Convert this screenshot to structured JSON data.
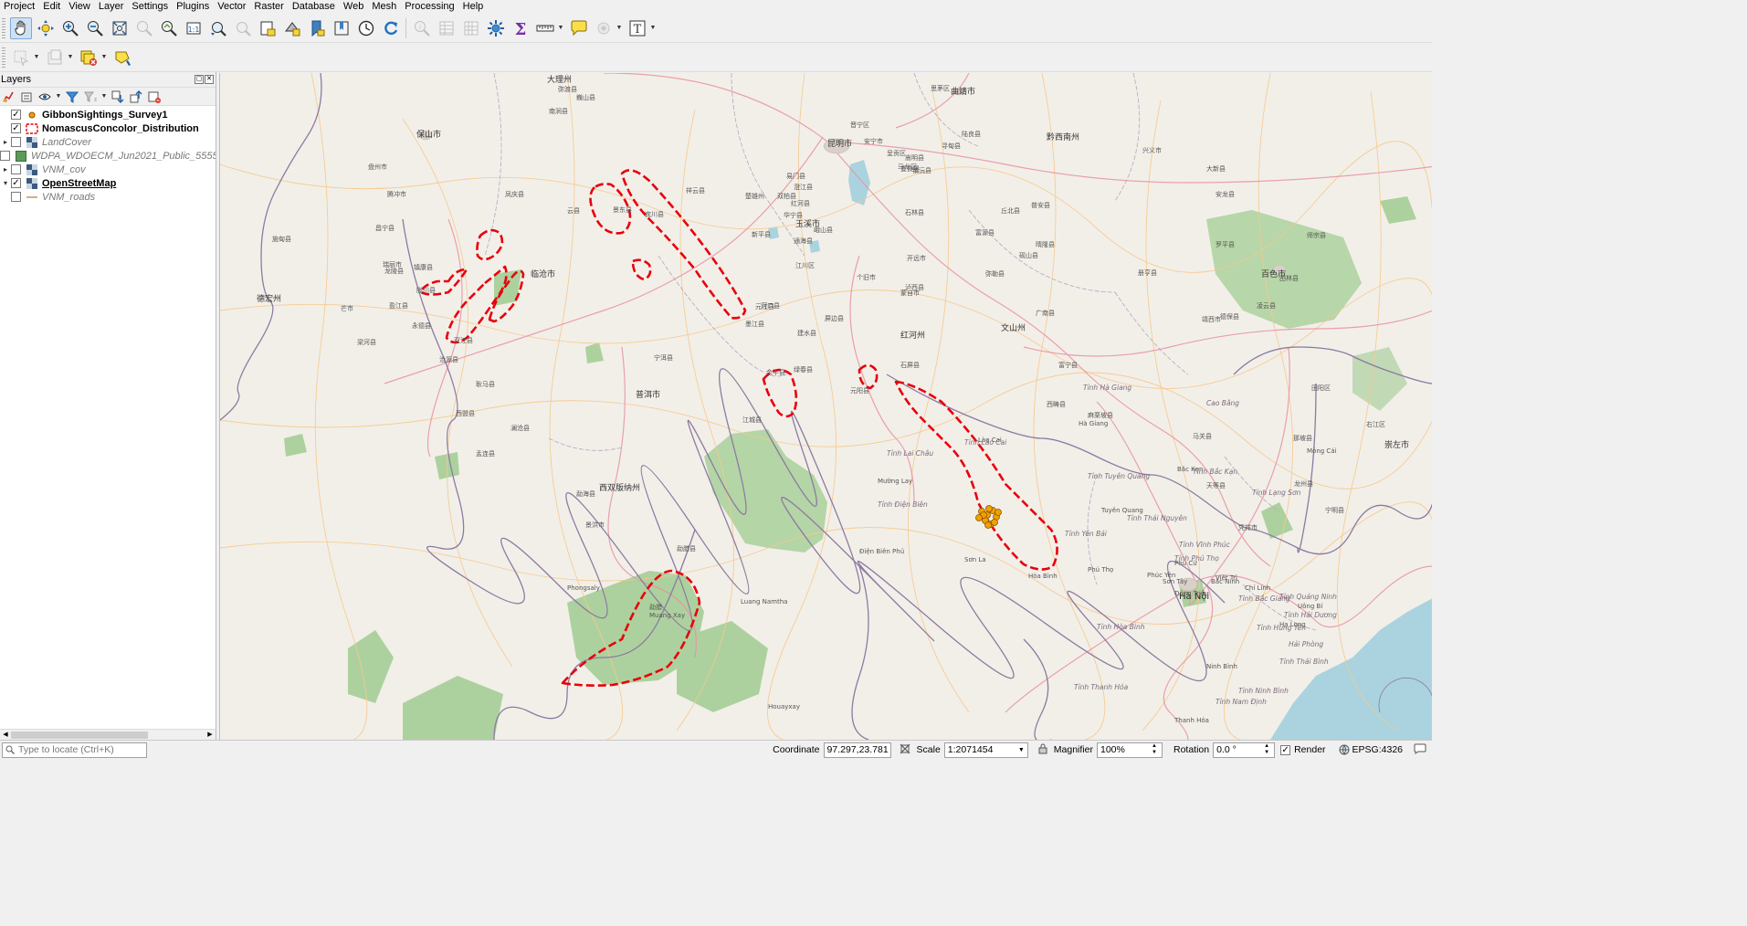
{
  "menu": {
    "items": [
      "Project",
      "Edit",
      "View",
      "Layer",
      "Settings",
      "Plugins",
      "Vector",
      "Raster",
      "Database",
      "Web",
      "Mesh",
      "Processing",
      "Help"
    ]
  },
  "layers_panel": {
    "title": "Layers",
    "layers": [
      {
        "name": "GibbonSightings_Survey1",
        "checked": true,
        "style": "bold",
        "expand": ""
      },
      {
        "name": "NomascusConcolor_Distribution",
        "checked": true,
        "style": "bold",
        "expand": ""
      },
      {
        "name": "LandCover",
        "checked": false,
        "style": "italic",
        "expand": "▸"
      },
      {
        "name": "WDPA_WDOECM_Jun2021_Public_55559",
        "checked": false,
        "style": "italic",
        "expand": ""
      },
      {
        "name": "VNM_cov",
        "checked": false,
        "style": "italic",
        "expand": "▸"
      },
      {
        "name": "OpenStreetMap",
        "checked": true,
        "style": "underline",
        "expand": "▾"
      },
      {
        "name": "VNM_roads",
        "checked": false,
        "style": "italic",
        "expand": ""
      }
    ]
  },
  "map_labels": [
    {
      "text": "大理州",
      "cls": "city"
    },
    {
      "text": "保山市",
      "cls": "city"
    },
    {
      "text": "临沧市",
      "cls": "city"
    },
    {
      "text": "普洱市",
      "cls": "city"
    },
    {
      "text": "昆明市",
      "cls": "city"
    },
    {
      "text": "玉溪市",
      "cls": "city"
    },
    {
      "text": "红河州",
      "cls": "city"
    },
    {
      "text": "文山州",
      "cls": "city"
    },
    {
      "text": "西双版纳州",
      "cls": "city"
    },
    {
      "text": "曲靖市",
      "cls": "city"
    },
    {
      "text": "黔西南州",
      "cls": "city"
    },
    {
      "text": "百色市",
      "cls": "city"
    },
    {
      "text": "崇左市",
      "cls": "city"
    },
    {
      "text": "德宏州",
      "cls": "city"
    },
    {
      "text": "Hà Nội",
      "cls": "big"
    },
    {
      "text": "Tỉnh Lai Châu",
      "cls": "vn"
    },
    {
      "text": "Tỉnh Điện Biên",
      "cls": "vn"
    },
    {
      "text": "Điện Biên Phủ",
      "cls": ""
    },
    {
      "text": "Mường Lay",
      "cls": ""
    },
    {
      "text": "Sơn La",
      "cls": ""
    },
    {
      "text": "Tỉnh Lào Cai",
      "cls": "vn"
    },
    {
      "text": "Tỉnh Hà Giang",
      "cls": "vn"
    },
    {
      "text": "Tỉnh Tuyên Quang",
      "cls": "vn"
    },
    {
      "text": "Tuyên Quang",
      "cls": ""
    },
    {
      "text": "Tỉnh Thái Nguyên",
      "cls": "vn"
    },
    {
      "text": "Tỉnh Lạng Sơn",
      "cls": "vn"
    },
    {
      "text": "Bắc Kạn",
      "cls": ""
    },
    {
      "text": "Tỉnh Bắc Kạn",
      "cls": "vn"
    },
    {
      "text": "Cao Bằng",
      "cls": "vn"
    },
    {
      "text": "Tỉnh Phú Thọ",
      "cls": "vn"
    },
    {
      "text": "Phú Thọ",
      "cls": ""
    },
    {
      "text": "Việt Trì",
      "cls": ""
    },
    {
      "text": "Phúc Yên",
      "cls": ""
    },
    {
      "text": "Bắc Ninh",
      "cls": ""
    },
    {
      "text": "Chí Linh",
      "cls": ""
    },
    {
      "text": "Uông Bí",
      "cls": ""
    },
    {
      "text": "Hạ Long",
      "cls": ""
    },
    {
      "text": "Tỉnh Hòa Bình",
      "cls": "vn"
    },
    {
      "text": "Tỉnh Thanh Hóa",
      "cls": "vn"
    },
    {
      "text": "Ninh Bình",
      "cls": ""
    },
    {
      "text": "Tỉnh Ninh Bình",
      "cls": "vn"
    },
    {
      "text": "Tỉnh Nam Định",
      "cls": "vn"
    },
    {
      "text": "Tỉnh Hải Dương",
      "cls": "vn"
    },
    {
      "text": "Tỉnh Quảng Ninh",
      "cls": "vn"
    },
    {
      "text": "Tỉnh Bắc Giang",
      "cls": "vn"
    },
    {
      "text": "Tỉnh Vĩnh Phúc",
      "cls": "vn"
    },
    {
      "text": "Tỉnh Yên Bái",
      "cls": "vn"
    },
    {
      "text": "Hải Phòng",
      "cls": "vn"
    },
    {
      "text": "Tỉnh Hưng Yên",
      "cls": "vn"
    },
    {
      "text": "Tỉnh Thái Bình",
      "cls": "vn"
    },
    {
      "text": "Hòa Bình",
      "cls": ""
    },
    {
      "text": "Thanh Hóa",
      "cls": ""
    },
    {
      "text": "Sơn Tây",
      "cls": ""
    },
    {
      "text": "Hà Giang",
      "cls": ""
    },
    {
      "text": "Phù Cừ",
      "cls": ""
    },
    {
      "text": "Đông Triều",
      "cls": ""
    },
    {
      "text": "Lào Cai",
      "cls": ""
    },
    {
      "text": "Móng Cái",
      "cls": ""
    },
    {
      "text": "江城县",
      "cls": ""
    },
    {
      "text": "勐腊县",
      "cls": ""
    },
    {
      "text": "景洪市",
      "cls": ""
    },
    {
      "text": "勐海县",
      "cls": ""
    },
    {
      "text": "澜沧县",
      "cls": ""
    },
    {
      "text": "孟连县",
      "cls": ""
    },
    {
      "text": "西盟县",
      "cls": ""
    },
    {
      "text": "沧源县",
      "cls": ""
    },
    {
      "text": "耿马县",
      "cls": ""
    },
    {
      "text": "双江县",
      "cls": ""
    },
    {
      "text": "永德县",
      "cls": ""
    },
    {
      "text": "镇康县",
      "cls": ""
    },
    {
      "text": "凤庆县",
      "cls": ""
    },
    {
      "text": "云县",
      "cls": ""
    },
    {
      "text": "景东县",
      "cls": ""
    },
    {
      "text": "南涧县",
      "cls": ""
    },
    {
      "text": "弥渡县",
      "cls": ""
    },
    {
      "text": "巍山县",
      "cls": ""
    },
    {
      "text": "新平县",
      "cls": ""
    },
    {
      "text": "元江县",
      "cls": ""
    },
    {
      "text": "墨江县",
      "cls": ""
    },
    {
      "text": "宁洱县",
      "cls": ""
    },
    {
      "text": "绿春县",
      "cls": ""
    },
    {
      "text": "元阳县",
      "cls": ""
    },
    {
      "text": "金平县",
      "cls": ""
    },
    {
      "text": "河口县",
      "cls": ""
    },
    {
      "text": "屏边县",
      "cls": ""
    },
    {
      "text": "个旧市",
      "cls": ""
    },
    {
      "text": "蒙自市",
      "cls": ""
    },
    {
      "text": "开远市",
      "cls": ""
    },
    {
      "text": "建水县",
      "cls": ""
    },
    {
      "text": "石屏县",
      "cls": ""
    },
    {
      "text": "红河县",
      "cls": ""
    },
    {
      "text": "通海县",
      "cls": ""
    },
    {
      "text": "华宁县",
      "cls": ""
    },
    {
      "text": "澄江县",
      "cls": ""
    },
    {
      "text": "宜良县",
      "cls": ""
    },
    {
      "text": "石林县",
      "cls": ""
    },
    {
      "text": "泸西县",
      "cls": ""
    },
    {
      "text": "弥勒县",
      "cls": ""
    },
    {
      "text": "丘北县",
      "cls": ""
    },
    {
      "text": "砚山县",
      "cls": ""
    },
    {
      "text": "广南县",
      "cls": ""
    },
    {
      "text": "富宁县",
      "cls": ""
    },
    {
      "text": "西畴县",
      "cls": ""
    },
    {
      "text": "麻栗坡县",
      "cls": ""
    },
    {
      "text": "马关县",
      "cls": ""
    },
    {
      "text": "那坡县",
      "cls": ""
    },
    {
      "text": "靖西市",
      "cls": ""
    },
    {
      "text": "德保县",
      "cls": ""
    },
    {
      "text": "田林县",
      "cls": ""
    },
    {
      "text": "凌云县",
      "cls": ""
    },
    {
      "text": "右江区",
      "cls": ""
    },
    {
      "text": "田阳区",
      "cls": ""
    },
    {
      "text": "龙州县",
      "cls": ""
    },
    {
      "text": "宁明县",
      "cls": ""
    },
    {
      "text": "凭祥市",
      "cls": ""
    },
    {
      "text": "天等县",
      "cls": ""
    },
    {
      "text": "大新县",
      "cls": ""
    },
    {
      "text": "罗平县",
      "cls": ""
    },
    {
      "text": "师宗县",
      "cls": ""
    },
    {
      "text": "兴义市",
      "cls": ""
    },
    {
      "text": "安龙县",
      "cls": ""
    },
    {
      "text": "册亨县",
      "cls": ""
    },
    {
      "text": "晴隆县",
      "cls": ""
    },
    {
      "text": "普安县",
      "cls": ""
    },
    {
      "text": "盘州市",
      "cls": ""
    },
    {
      "text": "腾冲市",
      "cls": ""
    },
    {
      "text": "龙陵县",
      "cls": ""
    },
    {
      "text": "施甸县",
      "cls": ""
    },
    {
      "text": "昌宁县",
      "cls": ""
    },
    {
      "text": "芒市",
      "cls": ""
    },
    {
      "text": "瑞丽市",
      "cls": ""
    },
    {
      "text": "陇川县",
      "cls": ""
    },
    {
      "text": "盈江县",
      "cls": ""
    },
    {
      "text": "梁河县",
      "cls": ""
    },
    {
      "text": "宾川县",
      "cls": ""
    },
    {
      "text": "祥云县",
      "cls": ""
    },
    {
      "text": "楚雄州",
      "cls": ""
    },
    {
      "text": "双柏县",
      "cls": ""
    },
    {
      "text": "易门县",
      "cls": ""
    },
    {
      "text": "峨山县",
      "cls": ""
    },
    {
      "text": "江川区",
      "cls": ""
    },
    {
      "text": "晋宁区",
      "cls": ""
    },
    {
      "text": "安宁市",
      "cls": ""
    },
    {
      "text": "呈贡区",
      "cls": ""
    },
    {
      "text": "嵩明县",
      "cls": ""
    },
    {
      "text": "寻甸县",
      "cls": ""
    },
    {
      "text": "马龙区",
      "cls": ""
    },
    {
      "text": "陆良县",
      "cls": ""
    },
    {
      "text": "富源县",
      "cls": ""
    },
    {
      "text": "镇沅县",
      "cls": ""
    },
    {
      "text": "思茅区",
      "cls": ""
    },
    {
      "text": "勐腊",
      "cls": ""
    },
    {
      "text": "Phongsaly",
      "cls": ""
    },
    {
      "text": "Muang Xay",
      "cls": ""
    },
    {
      "text": "Luang Namtha",
      "cls": ""
    },
    {
      "text": "Houayxay",
      "cls": ""
    }
  ],
  "status": {
    "locator_placeholder": "Type to locate (Ctrl+K)",
    "coordinate_label": "Coordinate",
    "coordinate_value": "97.297,23.781",
    "scale_label": "Scale",
    "scale_value": "1:2071454",
    "magnifier_label": "Magnifier",
    "magnifier_value": "100%",
    "rotation_label": "Rotation",
    "rotation_value": "0.0 °",
    "render_label": "Render",
    "render_checked": true,
    "crs": "EPSG:4326"
  },
  "colors": {
    "distribution_outline": "#e8000b",
    "sightings_fill": "#f0a000",
    "sightings_stroke": "#8a5200",
    "forest": "#add19e",
    "sea": "#aad3df",
    "map_bg": "#f2efe9",
    "boundary": "#8c7aa0"
  },
  "icons": {
    "pan": "pan-hand-icon",
    "zoom_in": "zoom-in-icon",
    "zoom_out": "zoom-out-icon",
    "identify": "identify-icon",
    "python": "python-console-icon",
    "stats": "sum-icon",
    "measure": "measure-icon",
    "annotation": "annotation-icon",
    "text": "text-annotation-icon"
  }
}
